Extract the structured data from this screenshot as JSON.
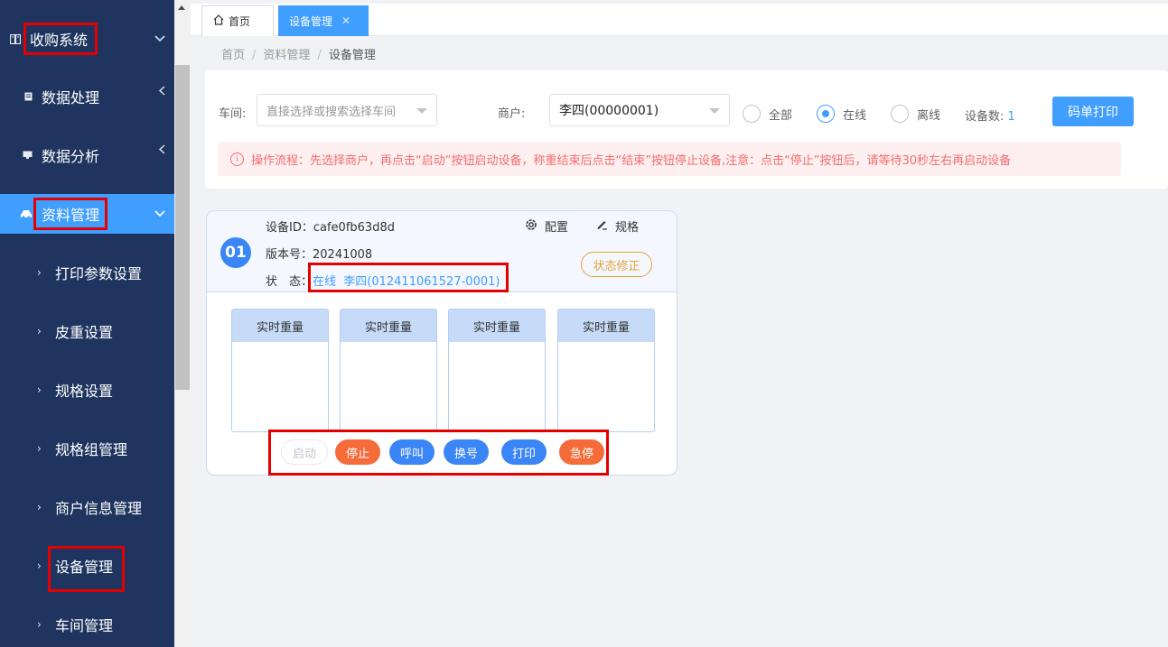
{
  "sidebar": {
    "menus": [
      {
        "label": "收购系统",
        "icon": "book-icon",
        "expanded": true
      },
      {
        "label": "数据处理",
        "icon": "document-icon",
        "expanded": false
      },
      {
        "label": "数据分析",
        "icon": "monitor-icon",
        "expanded": false
      },
      {
        "label": "资料管理",
        "icon": "car-icon",
        "expanded": true,
        "active": true
      }
    ],
    "sub_items": [
      "打印参数设置",
      "皮重设置",
      "规格设置",
      "规格组管理",
      "商户信息管理",
      "设备管理",
      "车间管理"
    ]
  },
  "tabs": {
    "home_label": "首页",
    "active_label": "设备管理"
  },
  "breadcrumb": {
    "items": [
      "首页",
      "资料管理",
      "设备管理"
    ]
  },
  "filters": {
    "workshop_label": "车间:",
    "workshop_placeholder": "直接选择或搜索选择车间",
    "merchant_label": "商户:",
    "merchant_value": "李四(00000001)",
    "radio_options": [
      "全部",
      "在线",
      "离线"
    ],
    "radio_selected": "在线",
    "device_count_label": "设备数:",
    "device_count": "1",
    "print_button": "码单打印"
  },
  "alert": {
    "text": "操作流程：先选择商户，再点击“启动”按钮启动设备，称重结束后点击“结束”按钮停止设备,注意：点击“停止”按钮后，请等待30秒左右再启动设备"
  },
  "device": {
    "index": "01",
    "id_label": "设备ID：",
    "id_value": "cafe0fb63d8d",
    "version_label": "版本号：",
    "version_value": "20241008",
    "status_label": "状　态：",
    "status_value": "在线  李四(012411061527-0001)",
    "config_label": "配置",
    "spec_label": "规格",
    "fix_label": "状态修正",
    "weight_title": "实时重量",
    "weight_slots": 4,
    "buttons": [
      {
        "label": "启动",
        "style": "disabled"
      },
      {
        "label": "停止",
        "style": "red"
      },
      {
        "label": "呼叫",
        "style": "blue"
      },
      {
        "label": "换号",
        "style": "blue"
      },
      {
        "label": "打印",
        "style": "blue"
      },
      {
        "label": "急停",
        "style": "red"
      }
    ]
  },
  "colors": {
    "sidebar_bg": "#1f3560",
    "accent": "#409eff",
    "danger": "#f56c3a",
    "warning": "#e6a23c"
  }
}
